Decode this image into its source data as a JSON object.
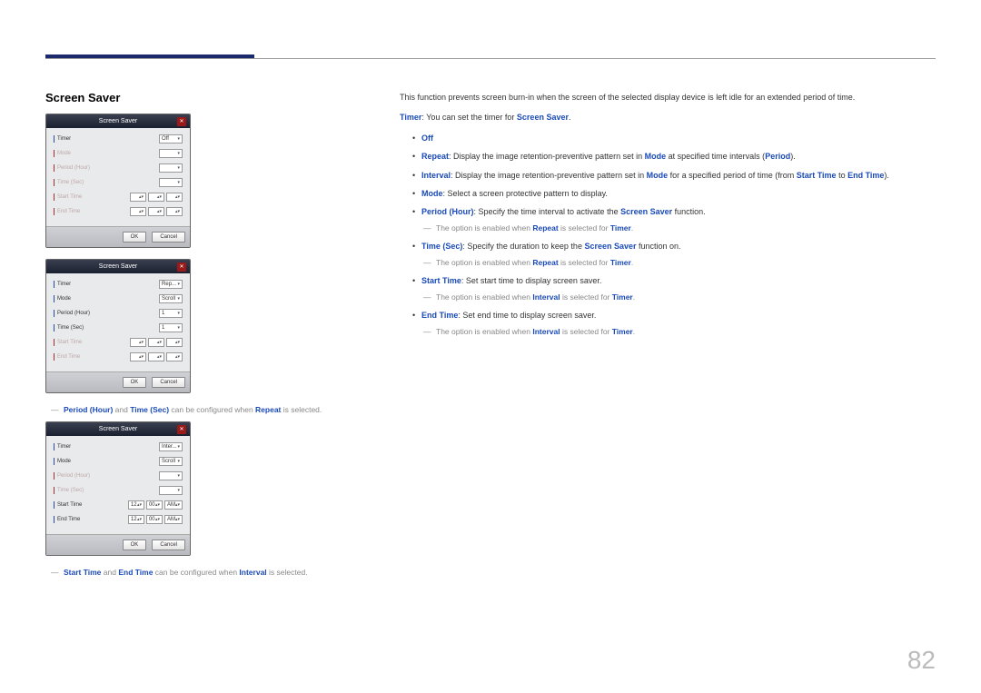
{
  "section_title": "Screen Saver",
  "page_number": "82",
  "dialogs": {
    "title": "Screen Saver",
    "ok": "OK",
    "cancel": "Cancel",
    "labels": {
      "timer": "Timer",
      "mode": "Mode",
      "period": "Period (Hour)",
      "time_sec": "Time (Sec)",
      "start_time": "Start Time",
      "end_time": "End Time"
    },
    "d1": {
      "timer": "Off"
    },
    "d2": {
      "timer": "Rep...",
      "mode": "Scroll",
      "period": "1",
      "time_sec": "1"
    },
    "d3": {
      "timer": "Inter...",
      "mode": "Scroll",
      "start_h": "12",
      "start_m": "00",
      "start_ap": "AM",
      "end_h": "12",
      "end_m": "00",
      "end_ap": "AM"
    }
  },
  "notes": {
    "n1_a": "Period (Hour)",
    "n1_b": "Time (Sec)",
    "n1_c": "Repeat",
    "n1_text_a": " and ",
    "n1_text_b": " can be configured when ",
    "n1_text_c": " is selected.",
    "n2_a": "Start Time",
    "n2_b": "End Time",
    "n2_c": "Interval",
    "n2_text_a": " and ",
    "n2_text_b": " can be configured when ",
    "n2_text_c": " is selected."
  },
  "right": {
    "intro": "This function prevents screen burn-in when the screen of the selected display device is left idle for an extended period of time.",
    "timer_label": "Timer",
    "timer_text": ": You can set the timer for ",
    "timer_target": "Screen Saver",
    "off": "Off",
    "repeat_label": "Repeat",
    "repeat_text_a": ": Display the image retention-preventive pattern set in ",
    "repeat_mode": "Mode",
    "repeat_text_b": " at specified time intervals (",
    "repeat_period": "Period",
    "repeat_text_c": ").",
    "interval_label": "Interval",
    "interval_text_a": ": Display the image retention-preventive pattern set in ",
    "interval_mode": "Mode",
    "interval_text_b": " for a specified period of time (from ",
    "interval_start": "Start Time",
    "interval_text_c": " to ",
    "interval_end": "End Time",
    "interval_text_d": ").",
    "mode_label": "Mode",
    "mode_text": ": Select a screen protective pattern to display.",
    "period_label": "Period (Hour)",
    "period_text_a": ": Specify the time interval to activate the ",
    "period_target": "Screen Saver",
    "period_text_b": " function.",
    "period_note_a": "The option is enabled when ",
    "period_note_r": "Repeat",
    "period_note_b": " is selected for ",
    "period_note_t": "Timer",
    "timesec_label": "Time (Sec)",
    "timesec_text_a": ": Specify the duration to keep the ",
    "timesec_target": "Screen Saver",
    "timesec_text_b": " function on.",
    "start_label": "Start Time",
    "start_text": ": Set start time to display screen saver.",
    "start_note_a": "The option is enabled when ",
    "start_note_i": "Interval",
    "start_note_b": " is selected for ",
    "start_note_t": "Timer",
    "end_label": "End Time",
    "end_text": ": Set end time to display screen saver."
  }
}
